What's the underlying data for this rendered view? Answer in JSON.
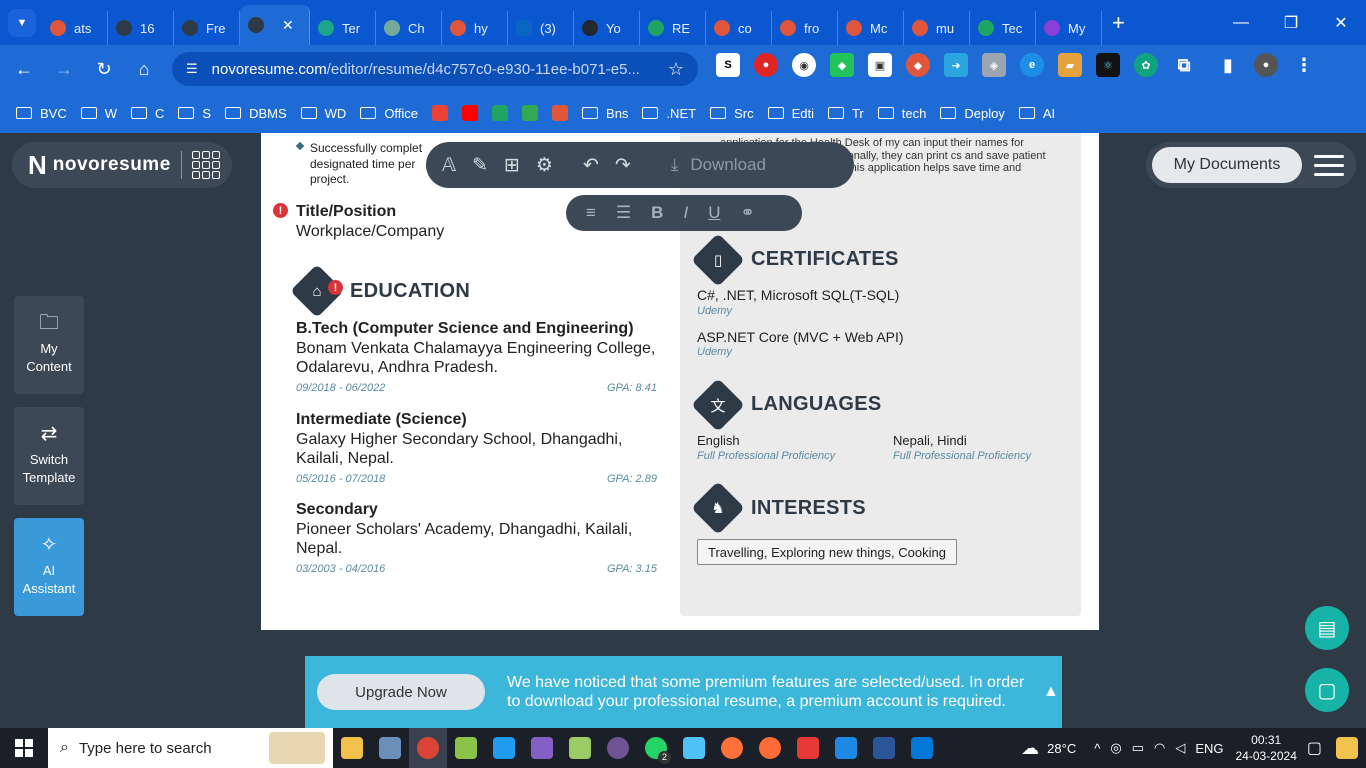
{
  "browser": {
    "tabs": [
      {
        "label": "ats",
        "color": "#e0563b"
      },
      {
        "label": "16",
        "color": "#2f3a47"
      },
      {
        "label": "Fre",
        "color": "#2f3a47"
      },
      {
        "label": "",
        "color": "#2f3a47",
        "active": true
      },
      {
        "label": "Ter",
        "color": "#19a68a"
      },
      {
        "label": "Ch",
        "color": "#74aa9c"
      },
      {
        "label": "hy",
        "color": "#e0563b"
      },
      {
        "label": "(3)",
        "color": "#0a66c2"
      },
      {
        "label": "Yo",
        "color": "#24292f"
      },
      {
        "label": "RE",
        "color": "#1fa463"
      },
      {
        "label": "co",
        "color": "#e0563b"
      },
      {
        "label": "fro",
        "color": "#e0563b"
      },
      {
        "label": "Mc",
        "color": "#e0563b"
      },
      {
        "label": "mu",
        "color": "#e0563b"
      },
      {
        "label": "Tec",
        "color": "#1fa463"
      },
      {
        "label": "My",
        "color": "#8b3fd9"
      }
    ],
    "url_host": "novoresume.com",
    "url_path": "/editor/resume/d4c757c0-e930-11ee-b071-e5...",
    "bookmarks": [
      "BVC",
      "W",
      "C",
      "S",
      "DBMS",
      "WD",
      "Office",
      "Bns",
      ".NET",
      "Src",
      "Edti",
      "Tr",
      "tech",
      "Deploy",
      "AI"
    ]
  },
  "app": {
    "logo_text": "novoresume",
    "my_documents": "My Documents",
    "toolbar_download": "Download",
    "side": {
      "my_content": "My Content",
      "switch_template": "Switch Template",
      "ai_assistant": "AI Assistant"
    }
  },
  "resume": {
    "top_bullet": "Successfully complet designated time per project.",
    "title_position": "Title/Position",
    "workplace": "Workplace/Company",
    "education_heading": "EDUCATION",
    "education": [
      {
        "degree": "B.Tech (Computer Science and Engineering)",
        "school": "Bonam Venkata Chalamayya Engineering College, Odalarevu, Andhra Pradesh.",
        "dates": "09/2018 - 06/2022",
        "gpa": "GPA: 8.41"
      },
      {
        "degree": "Intermediate (Science)",
        "school": "Galaxy Higher Secondary School, Dhangadhi, Kailali, Nepal.",
        "dates": "05/2016 - 07/2018",
        "gpa": "GPA: 2.89"
      },
      {
        "degree": "Secondary",
        "school": "Pioneer Scholars' Academy, Dhangadhi, Kailali, Nepal.",
        "dates": "03/2003 - 04/2016",
        "gpa": "GPA: 3.15"
      }
    ],
    "project_snippet": "application for the Health Desk of my can input their names for checkup, nual entry. Additionally, they can print cs and save patient data for future reference. This application helps save time and streamline",
    "certificates_heading": "CERTIFICATES",
    "certificates": [
      {
        "name": "C#, .NET, Microsoft SQL(T-SQL)",
        "issuer": "Udemy"
      },
      {
        "name": "ASP.NET Core (MVC + Web API)",
        "issuer": "Udemy"
      }
    ],
    "languages_heading": "LANGUAGES",
    "languages": [
      {
        "name": "English",
        "level": "Full Professional Proficiency"
      },
      {
        "name": "Nepali, Hindi",
        "level": "Full Professional Proficiency"
      }
    ],
    "interests_heading": "INTERESTS",
    "interests": "Travelling, Exploring new things, Cooking"
  },
  "banner": {
    "upgrade_label": "Upgrade Now",
    "message": "We have noticed that some premium features are selected/used. In order to download your professional resume, a premium account is required."
  },
  "taskbar": {
    "search_placeholder": "Type here to search",
    "temperature": "28°C",
    "language": "ENG",
    "time": "00:31",
    "date": "24-03-2024",
    "whatsapp_badge": "2"
  }
}
